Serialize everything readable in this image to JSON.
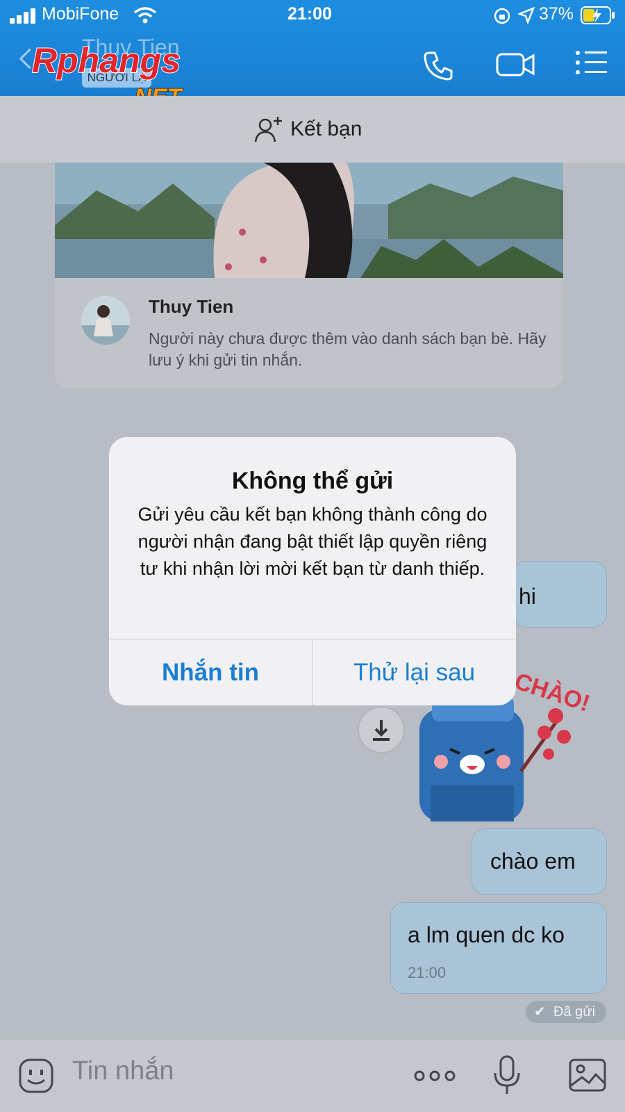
{
  "status_bar": {
    "carrier": "MobiFone",
    "time": "21:00",
    "battery": "37%"
  },
  "header": {
    "contact_name": "Thuy Tien",
    "badge": "NGƯỜI LẠ",
    "watermark_top": "Rphangs",
    "watermark_bottom": ".NET",
    "icons": [
      "back-chevron-icon",
      "phone-icon",
      "video-call-icon",
      "menu-list-icon"
    ]
  },
  "friend_bar": {
    "label": "Kết bạn",
    "icon": "add-friend-icon"
  },
  "profile_card": {
    "name": "Thuy Tien",
    "description": "Người này chưa được thêm vào danh sách bạn bè. Hãy lưu ý khi gửi tin nhắn."
  },
  "messages": [
    {
      "text": "hi",
      "partially_hidden": true
    },
    {
      "text": "chào em"
    },
    {
      "text": "a lm quen dc ko",
      "time": "21:00"
    }
  ],
  "sticker": {
    "caption": "CHÀO!"
  },
  "sent_status": "Đã gửi",
  "input": {
    "placeholder": "Tin nhắn",
    "icons": [
      "emoji-icon",
      "more-options-icon",
      "microphone-icon",
      "image-icon"
    ]
  },
  "dialog": {
    "title": "Không thể gửi",
    "message": "Gửi yêu cầu kết bạn không thành công do người nhận đang bật thiết lập quyền riêng tư khi nhận lời mời kết bạn từ danh thiếp.",
    "buttons": {
      "primary": "Nhắn tin",
      "secondary": "Thử lại sau"
    }
  },
  "colors": {
    "header_blue": "#1a7fd2",
    "accent_link": "#1a7fd2",
    "bubble": "#a9c3d7",
    "dialog_bg": "#f1f1f3",
    "watermark_red": "#e3242b",
    "watermark_orange": "#f39a1d"
  }
}
